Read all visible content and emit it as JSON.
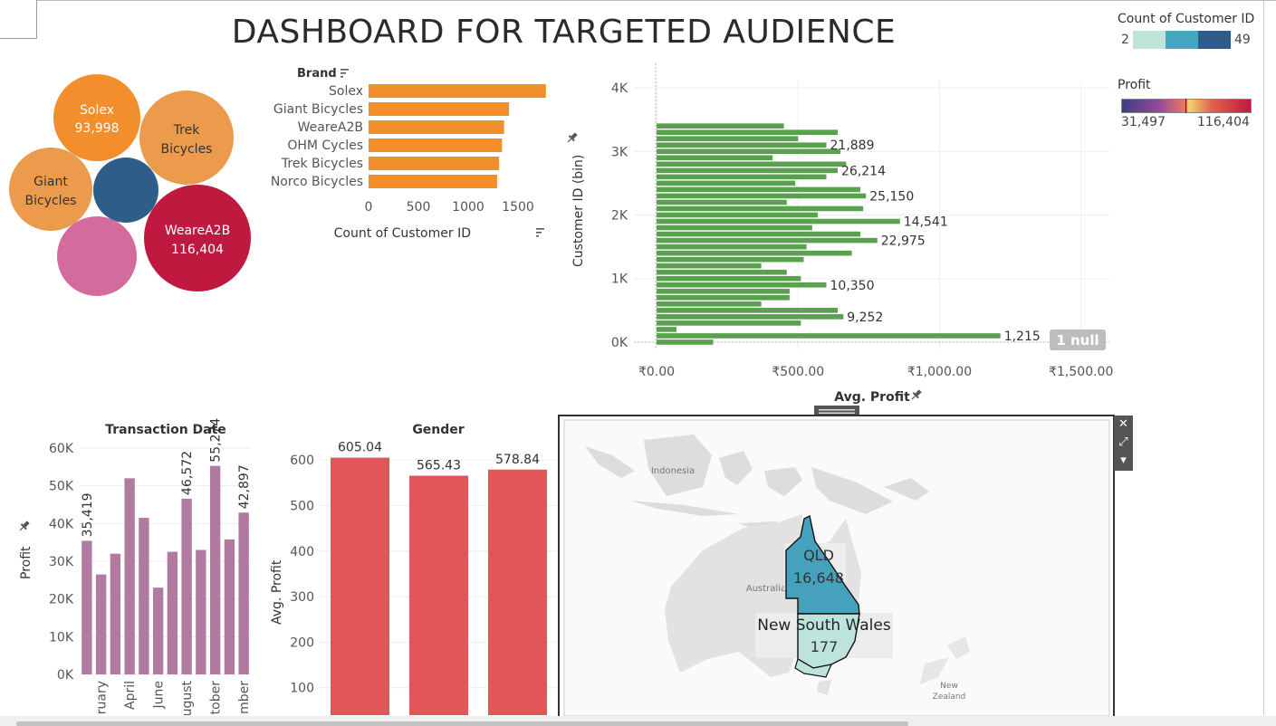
{
  "title": "DASHBOARD FOR TARGETED AUDIENCE",
  "legend_count": {
    "title": "Count of Customer ID",
    "min": "2",
    "max": "49",
    "colors": [
      "#bfe5da",
      "#46a8c0",
      "#2d5b8a"
    ]
  },
  "legend_profit": {
    "title": "Profit",
    "min": "31,497",
    "max": "116,404"
  },
  "colors": {
    "orange": "#f28e2b",
    "green": "#59a14f",
    "purple": "#b07aa1",
    "red": "#e15759",
    "qld": "#46a1bd",
    "nsw": "#bde4da"
  },
  "chart_data": [
    {
      "type": "bubble",
      "bubbles": [
        {
          "label": "Solex",
          "value": "93,998",
          "color": "#e2604f"
        },
        {
          "label": "Trek Bicycles",
          "value": "",
          "color": "#ec9b4c"
        },
        {
          "label": "Giant Bicycles",
          "value": "",
          "color": "#ec9b4c"
        },
        {
          "label": "",
          "value": "",
          "color": "#2f5d8a"
        },
        {
          "label": "WeareA2B",
          "value": "116,404",
          "color": "#c0193f"
        },
        {
          "label": "",
          "value": "",
          "color": "#d36b9c"
        }
      ]
    },
    {
      "type": "bar",
      "orientation": "horizontal",
      "header": "Brand",
      "categories": [
        "Solex",
        "Giant Bicycles",
        "WeareA2B",
        "OHM Cycles",
        "Trek Bicycles",
        "Norco Bicycles"
      ],
      "values": [
        1780,
        1410,
        1360,
        1340,
        1310,
        1290
      ],
      "xlabel": "Count of Customer ID",
      "xticks": [
        "0",
        "500",
        "1000",
        "1500"
      ],
      "xlim": [
        0,
        1800
      ]
    },
    {
      "type": "bar",
      "orientation": "horizontal",
      "ylabel": "Customer ID (bin)",
      "xlabel": "Avg. Profit",
      "yticks": [
        "0K",
        "1K",
        "2K",
        "3K",
        "4K"
      ],
      "xticks": [
        "₹0.00",
        "₹500.00",
        "₹1,000.00",
        "₹1,500.00"
      ],
      "xlim": [
        0,
        1600
      ],
      "ylim": [
        -100,
        4100
      ],
      "bin_width": 100,
      "values": [
        200,
        1215,
        70,
        510,
        660,
        640,
        370,
        470,
        470,
        600,
        510,
        460,
        370,
        520,
        690,
        530,
        780,
        720,
        550,
        860,
        570,
        730,
        460,
        740,
        720,
        490,
        600,
        640,
        670,
        410,
        650,
        600,
        500,
        640,
        450
      ],
      "bar_labels": [
        {
          "bin": 1,
          "text": "1,215"
        },
        {
          "bin": 4,
          "text": "9,252"
        },
        {
          "bin": 9,
          "text": "10,350"
        },
        {
          "bin": 16,
          "text": "22,975"
        },
        {
          "bin": 19,
          "text": "14,541"
        },
        {
          "bin": 23,
          "text": "25,150"
        },
        {
          "bin": 27,
          "text": "26,214"
        },
        {
          "bin": 31,
          "text": "21,889"
        }
      ],
      "null_badge": "1 null"
    },
    {
      "type": "bar",
      "title": "Transaction Date",
      "ylabel": "Profit",
      "yticks": [
        "0K",
        "10K",
        "20K",
        "30K",
        "40K",
        "50K",
        "60K"
      ],
      "ylim": [
        0,
        60000
      ],
      "values": [
        35419,
        26500,
        32000,
        52000,
        41500,
        23000,
        32500,
        46572,
        33000,
        55274,
        35800,
        42897
      ],
      "bar_labels": [
        "35,419",
        "",
        "",
        "",
        "",
        "",
        "",
        "46,572",
        "",
        "55,274",
        "",
        "42,897"
      ],
      "xtick_labels": [
        "ruary",
        "April",
        "June",
        "ugust",
        "tober",
        "mber"
      ]
    },
    {
      "type": "bar",
      "title": "Gender",
      "ylabel": "Avg. Profit",
      "yticks": [
        "100",
        "200",
        "300",
        "400",
        "500",
        "600"
      ],
      "ylim": [
        0,
        640
      ],
      "values": [
        605.04,
        565.43,
        578.84
      ],
      "bar_labels": [
        "605.04",
        "565.43",
        "578.84"
      ]
    }
  ],
  "map": {
    "labels": {
      "indonesia": "Indonesia",
      "australia": "Australia",
      "new_zealand_1": "New",
      "new_zealand_2": "Zealand"
    },
    "regions": [
      {
        "name": "QLD",
        "value": "16,648"
      },
      {
        "name": "New South Wales",
        "value": "177"
      }
    ],
    "controls": {
      "close": "✕",
      "popout": "⤢",
      "menu": "▾"
    }
  }
}
